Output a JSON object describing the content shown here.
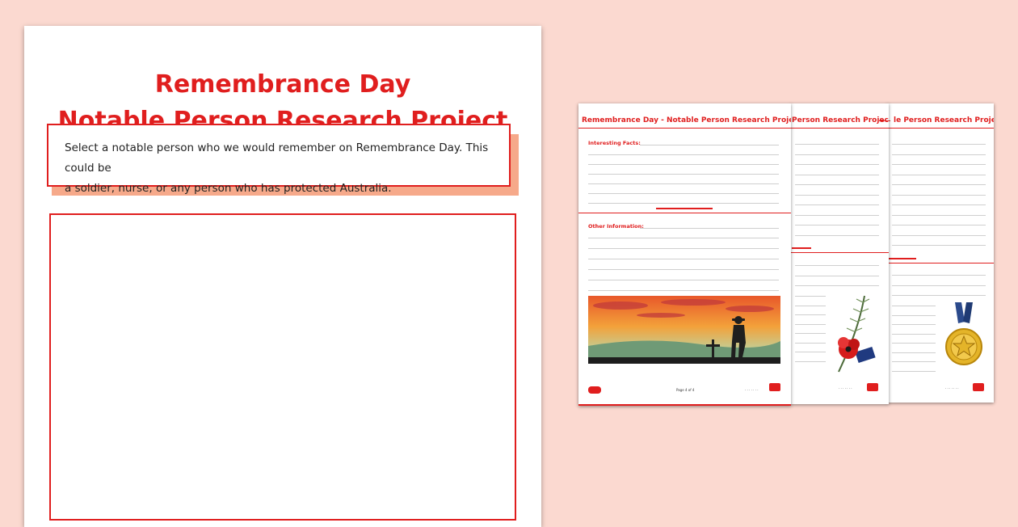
{
  "main_sheet": {
    "title_line1": "Remembrance Day",
    "title_line2": "Notable Person Research Project",
    "intro_line1": "Select a notable person who we would remember on Remembrance Day. This could be",
    "intro_line2": "a soldier, nurse, or any person who has protected Australia."
  },
  "thumbnails": [
    {
      "header": "Remembrance Day - Notable Person Research Project",
      "section1": "Interesting Facts:",
      "section2": "Other Information:",
      "footer_page": "Page 4 of 4",
      "illustration": "soldier-silhouette-sunset"
    },
    {
      "header": "Person Research Project",
      "illustration": "poppy-rosemary-flag"
    },
    {
      "header": "le Person Research Project",
      "illustration": "gold-star-medal"
    }
  ],
  "colors": {
    "background": "#fbd9d0",
    "accent_red": "#e01e1e",
    "shadow_peach": "#f6a98a"
  }
}
